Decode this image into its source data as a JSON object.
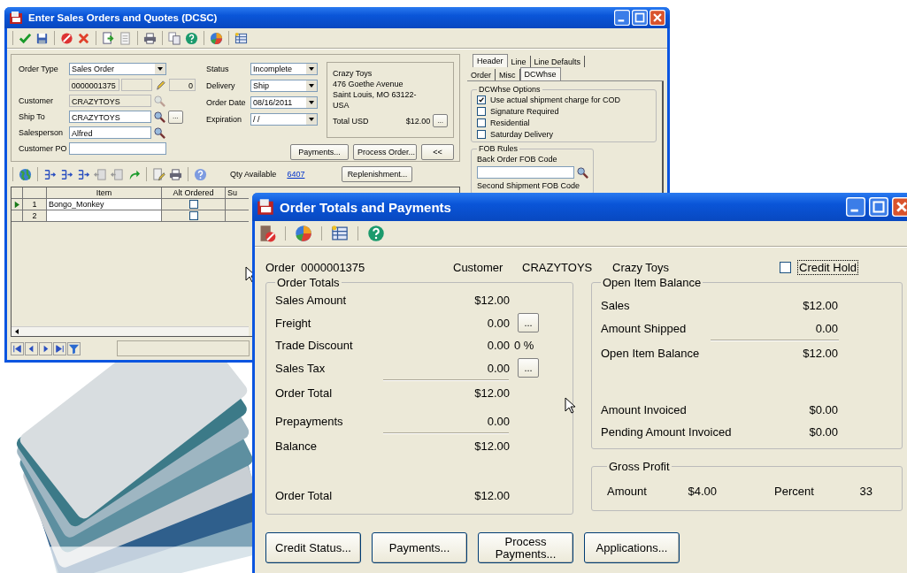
{
  "sales_window": {
    "title": "Enter Sales Orders and Quotes (DCSC)",
    "order_type": {
      "label": "Order Type",
      "value": "Sales Order"
    },
    "order_number": "0000001375",
    "line_count": "0",
    "customer": {
      "label": "Customer",
      "value": "CRAZYTOYS",
      "disabled": true
    },
    "ship_to": {
      "label": "Ship To",
      "value": "CRAZYTOYS",
      "button": "..."
    },
    "salesperson": {
      "label": "Salesperson",
      "value": "Alfred"
    },
    "customer_po": {
      "label": "Customer PO"
    },
    "status": {
      "label": "Status",
      "value": "Incomplete"
    },
    "delivery": {
      "label": "Delivery",
      "value": "Ship"
    },
    "order_date": {
      "label": "Order Date",
      "value": "08/16/2011"
    },
    "expiration": {
      "label": "Expiration",
      "value": "/ /"
    },
    "address": [
      "Crazy Toys",
      "476 Goethe Avenue",
      "Saint Louis, MO 63122-",
      "USA"
    ],
    "total": {
      "label": "Total USD",
      "value": "$12.00",
      "button": "..."
    },
    "buttons": [
      "Payments...",
      "Process Order...",
      "<<"
    ],
    "qty": {
      "label": "Qty Available",
      "value": "6407"
    },
    "replenishment": "Replenishment...",
    "grid": {
      "columns": [
        "Item",
        "Alt Ordered",
        "Su"
      ],
      "rows": [
        {
          "number": "1",
          "item": "Bongo_Monkey",
          "alt_ordered": false,
          "current": true
        },
        {
          "number": "2",
          "alt_ordered": false,
          "current": false
        }
      ]
    },
    "tabs": [
      {
        "label": "Header",
        "selected": true
      },
      {
        "label": "Line",
        "selected": false
      },
      {
        "label": "Line Defaults",
        "selected": false
      }
    ],
    "subtabs": [
      {
        "label": "Order",
        "selected": false
      },
      {
        "label": "Misc",
        "selected": false
      },
      {
        "label": "DCWhse",
        "selected": true
      }
    ],
    "options": {
      "title": "DCWhse Options",
      "items": [
        {
          "label": "Use actual shipment charge for COD",
          "checked": true
        },
        {
          "label": "Signature Required",
          "checked": false
        },
        {
          "label": "Residential",
          "checked": false
        },
        {
          "label": "Saturday Delivery",
          "checked": false
        }
      ]
    },
    "fob": {
      "title": "FOB Rules",
      "back_order_label": "Back Order FOB Code",
      "second_label": "Second Shipment FOB Code"
    }
  },
  "totals_window": {
    "title": "Order Totals and Payments",
    "order_label": "Order",
    "order": "0000001375",
    "customer_label": "Customer",
    "customer_id": "CRAZYTOYS",
    "customer_name": "Crazy Toys",
    "credit_hold": {
      "label": "Credit Hold",
      "checked": false
    },
    "order_totals": {
      "title": "Order Totals",
      "rows": [
        {
          "kind": "plain",
          "label": "Sales Amount",
          "value": "$12.00"
        },
        {
          "kind": "button",
          "label": "Freight",
          "value": "0.00",
          "button": "..."
        },
        {
          "kind": "percent",
          "label": "Trade Discount",
          "value": "0.00",
          "suffix": "0 %"
        },
        {
          "kind": "button",
          "label": "Sales Tax",
          "value": "0.00",
          "button": "..."
        },
        {
          "kind": "sum",
          "label": "Order Total",
          "value": "$12.00"
        },
        {
          "kind": "spaced",
          "label": "Prepayments",
          "value": "0.00"
        },
        {
          "kind": "sum",
          "label": "Balance",
          "value": "$12.00"
        },
        {
          "kind": "grand",
          "label": "Order Total",
          "value": "$12.00"
        }
      ]
    },
    "open_item_balance": {
      "title": "Open Item Balance",
      "rows": [
        {
          "kind": "plain",
          "label": "Sales",
          "value": "$12.00"
        },
        {
          "kind": "plain",
          "label": "Amount Shipped",
          "value": "0.00"
        },
        {
          "kind": "sum",
          "label": "Open Item Balance",
          "value": "$12.00"
        },
        {
          "kind": "grand",
          "label": "Amount Invoiced",
          "value": "$0.00"
        },
        {
          "kind": "plain",
          "label": "Pending Amount Invoiced",
          "value": "$0.00"
        }
      ]
    },
    "gross_profit": {
      "title": "Gross Profit",
      "amount_label": "Amount",
      "amount": "$4.00",
      "percent_label": "Percent",
      "percent": "33"
    },
    "buttons": [
      "Credit Status...",
      "Payments...",
      "Process Payments...",
      "Applications..."
    ]
  }
}
